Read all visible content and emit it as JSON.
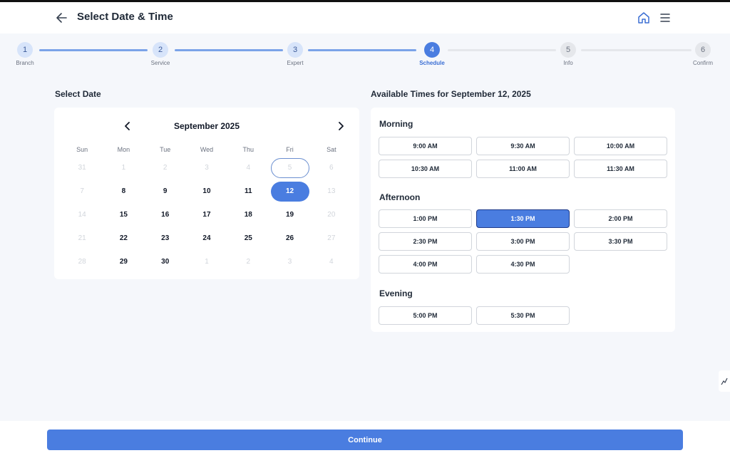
{
  "header": {
    "title": "Select Date & Time",
    "back_icon": "arrow-left-icon",
    "home_icon": "home-icon",
    "menu_icon": "hamburger-menu-icon"
  },
  "stepper": {
    "steps": [
      {
        "number": "1",
        "label": "Branch",
        "state": "done"
      },
      {
        "number": "2",
        "label": "Service",
        "state": "done"
      },
      {
        "number": "3",
        "label": "Expert",
        "state": "done"
      },
      {
        "number": "4",
        "label": "Schedule",
        "state": "active"
      },
      {
        "number": "5",
        "label": "Info",
        "state": "todo"
      },
      {
        "number": "6",
        "label": "Confirm",
        "state": "todo"
      }
    ],
    "accent": "#4a7de0"
  },
  "date_section": {
    "title": "Select Date",
    "month": "September 2025",
    "weekdays": [
      "Sun",
      "Mon",
      "Tue",
      "Wed",
      "Thu",
      "Fri",
      "Sat"
    ],
    "weeks": [
      [
        "31",
        "1",
        "2",
        "3",
        "4",
        "5",
        "6"
      ],
      [
        "7",
        "8",
        "9",
        "10",
        "11",
        "12",
        "13"
      ],
      [
        "14",
        "15",
        "16",
        "17",
        "18",
        "19",
        "20"
      ],
      [
        "21",
        "22",
        "23",
        "24",
        "25",
        "26",
        "27"
      ],
      [
        "28",
        "29",
        "30",
        "1",
        "2",
        "3",
        "4"
      ]
    ],
    "today": "5",
    "selected": "12"
  },
  "time_section": {
    "title": "Available Times for September 12, 2025",
    "periods": [
      {
        "name": "Morning",
        "slots": [
          "9:00 AM",
          "9:30 AM",
          "10:00 AM",
          "10:30 AM",
          "11:00 AM",
          "11:30 AM"
        ]
      },
      {
        "name": "Afternoon",
        "slots": [
          "1:00 PM",
          "1:30 PM",
          "2:00 PM",
          "2:30 PM",
          "3:00 PM",
          "3:30 PM",
          "4:00 PM",
          "4:30 PM"
        ]
      },
      {
        "name": "Evening",
        "slots": [
          "5:00 PM",
          "5:30 PM"
        ]
      }
    ],
    "selected": "1:30 PM"
  },
  "footer": {
    "continue_label": "Continue"
  }
}
